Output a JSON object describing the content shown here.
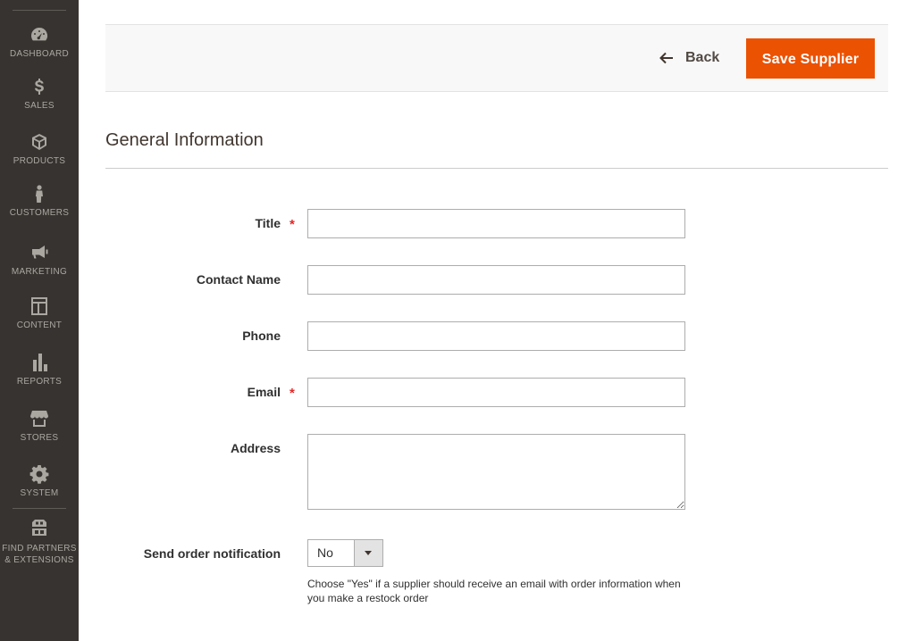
{
  "sidebar": {
    "items": [
      {
        "label": "DASHBOARD",
        "icon": "dashboard-icon"
      },
      {
        "label": "SALES",
        "icon": "dollar-icon"
      },
      {
        "label": "PRODUCTS",
        "icon": "box-icon"
      },
      {
        "label": "CUSTOMERS",
        "icon": "person-icon"
      },
      {
        "label": "MARKETING",
        "icon": "megaphone-icon"
      },
      {
        "label": "CONTENT",
        "icon": "layout-icon"
      },
      {
        "label": "REPORTS",
        "icon": "bar-chart-icon"
      },
      {
        "label": "STORES",
        "icon": "storefront-icon"
      },
      {
        "label": "SYSTEM",
        "icon": "gear-icon"
      }
    ],
    "extensions": {
      "line1": "FIND PARTNERS",
      "line2": "& EXTENSIONS",
      "icon": "blocks-icon"
    },
    "colors": {
      "background": "#373330",
      "text": "#aaa6a0"
    }
  },
  "actions": {
    "back_label": "Back",
    "save_label": "Save Supplier",
    "save_color": "#eb5202"
  },
  "section": {
    "title": "General Information"
  },
  "form": {
    "title": {
      "label": "Title",
      "value": "",
      "required": true
    },
    "contact_name": {
      "label": "Contact Name",
      "value": ""
    },
    "phone": {
      "label": "Phone",
      "value": ""
    },
    "email": {
      "label": "Email",
      "value": "",
      "required": true
    },
    "address": {
      "label": "Address",
      "value": ""
    },
    "send_notification": {
      "label": "Send order notification",
      "selected": "No",
      "note": "Choose \"Yes\" if a supplier should receive an email with order information when you make a restock order"
    },
    "required_marker": "*",
    "required_color": "#e22626"
  }
}
